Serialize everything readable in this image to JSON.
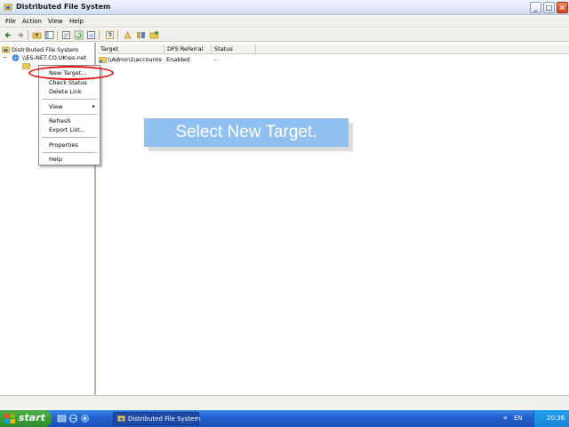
{
  "window": {
    "title": "Distributed File System",
    "controls": {
      "minimize": "_",
      "maximize": "□",
      "close": "×"
    }
  },
  "menubar": {
    "items": [
      "File",
      "Action",
      "View",
      "Help"
    ]
  },
  "toolbar": {
    "buttons": [
      "back-icon",
      "forward-icon",
      "up-folder-icon",
      "show-hide-tree-icon",
      "properties-icon",
      "refresh-icon",
      "export-icon",
      "help-icon",
      "new-root-icon",
      "new-link-icon",
      "new-target-icon"
    ]
  },
  "tree": {
    "root_label": "Distributed File System",
    "child_label": "\\\\ES-NET.CO.UK\\es-net"
  },
  "list": {
    "columns": [
      "Target",
      "DFS Referral",
      "Status"
    ],
    "rows": [
      {
        "target": "\\\\Admin1\\accounts",
        "referral": "Enabled",
        "status": "-"
      }
    ]
  },
  "context_menu": {
    "items": {
      "new_target": "New Target...",
      "check_status": "Check Status",
      "delete_link": "Delete Link",
      "view": "View",
      "view_arrow": "▸",
      "refresh": "Refresh",
      "export_list": "Export List...",
      "properties": "Properties",
      "help": "Help"
    }
  },
  "caption": {
    "text": "Select New Target."
  },
  "taskbar": {
    "start_label": "start",
    "active_task": "Distributed File System",
    "language": "EN",
    "tray_arrow": "«",
    "clock": "20:36"
  },
  "colors": {
    "caption_bg": "#8fc0ef",
    "highlight_ring": "#e01010",
    "taskbar": "#2460d0",
    "start": "#3a9c36"
  }
}
